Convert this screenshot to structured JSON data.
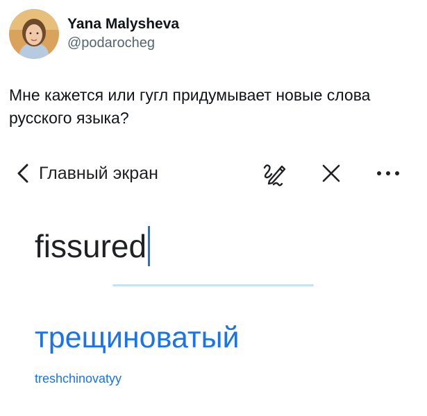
{
  "tweet": {
    "author": {
      "display_name": "Yana Malysheva",
      "handle": "@podarocheg"
    },
    "text": "Мне кажется или гугл придумывает новые слова русского языка?"
  },
  "translator": {
    "nav": {
      "back_label": "Главный экран",
      "icons": [
        "chevron-left-icon",
        "handwriting-icon",
        "close-icon",
        "more-horizontal-icon"
      ]
    },
    "source_text": "fissured",
    "translation": "трещиноватый",
    "transliteration": "treshchinovatyy"
  },
  "colors": {
    "text_primary": "#0f1419",
    "text_secondary": "#536471",
    "accent_blue": "#1a73e8",
    "divider": "#c6e0f5"
  }
}
